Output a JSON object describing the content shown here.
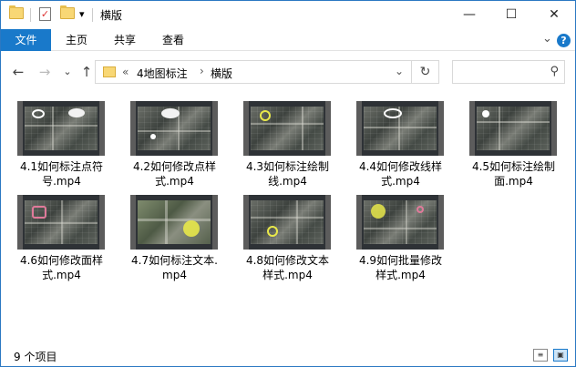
{
  "window": {
    "title": "横版",
    "dropdown_glyph": "▾",
    "minimize": "—",
    "maximize": "☐",
    "close": "✕"
  },
  "ribbon": {
    "tabs": [
      "文件",
      "主页",
      "共享",
      "查看"
    ],
    "expand_glyph": "⌄",
    "help_glyph": "?"
  },
  "nav": {
    "back_glyph": "←",
    "forward_glyph": "→",
    "recent_glyph": "⌄",
    "up_glyph": "↑",
    "overflow": "«",
    "path": [
      "4地图标注",
      "横版"
    ],
    "separator": "›",
    "dropdown_glyph": "⌄",
    "refresh_glyph": "↻",
    "search_placeholder": "",
    "search_glyph": "⚲"
  },
  "files": [
    {
      "line1": "4.1如何标注点符",
      "line2": "号.mp4"
    },
    {
      "line1": "4.2如何修改点样",
      "line2": "式.mp4"
    },
    {
      "line1": "4.3如何标注绘制",
      "line2": "线.mp4"
    },
    {
      "line1": "4.4如何修改线样",
      "line2": "式.mp4"
    },
    {
      "line1": "4.5如何标注绘制",
      "line2": "面.mp4"
    },
    {
      "line1": "4.6如何修改面样",
      "line2": "式.mp4"
    },
    {
      "line1": "4.7如何标注文本.",
      "line2": "mp4"
    },
    {
      "line1": "4.8如何修改文本",
      "line2": "样式.mp4"
    },
    {
      "line1": "4.9如何批量修改",
      "line2": "样式.mp4"
    }
  ],
  "status": {
    "item_count": "9 个项目"
  },
  "colors": {
    "accent": "#1979ca",
    "folder": "#f8d775",
    "highlight_yellow": "#e8e84a",
    "highlight_white": "#ffffff",
    "highlight_pink": "#e07a9a"
  }
}
